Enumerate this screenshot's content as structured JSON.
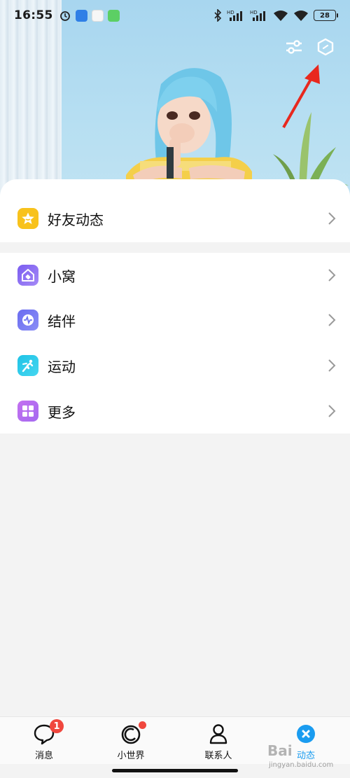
{
  "status_bar": {
    "time": "16:55",
    "battery": "28",
    "network_label": "HD"
  },
  "header": {
    "settings_icon": "sliders-icon",
    "action_icon": "hexagon-icon"
  },
  "menu": {
    "friends_feed": {
      "label": "好友动态",
      "icon": "star-icon",
      "color": "#f8c21c"
    },
    "items": [
      {
        "label": "小窝",
        "icon": "home-icon",
        "color": "#8a6cf0"
      },
      {
        "label": "结伴",
        "icon": "chat-wave-icon",
        "color": "#6f75f0"
      },
      {
        "label": "运动",
        "icon": "runner-icon",
        "color": "#2ec8e8"
      },
      {
        "label": "更多",
        "icon": "grid-icon",
        "color": "#b36ef0"
      }
    ]
  },
  "tabbar": {
    "tabs": [
      {
        "label": "消息",
        "icon": "message-icon",
        "badge": "1"
      },
      {
        "label": "小世界",
        "icon": "world-icon",
        "dot": true
      },
      {
        "label": "联系人",
        "icon": "contact-icon"
      },
      {
        "label": "动态",
        "icon": "star-burst-icon",
        "active": true
      }
    ]
  },
  "watermark": {
    "brand": "Bai",
    "url": "jingyan.baidu.com"
  }
}
